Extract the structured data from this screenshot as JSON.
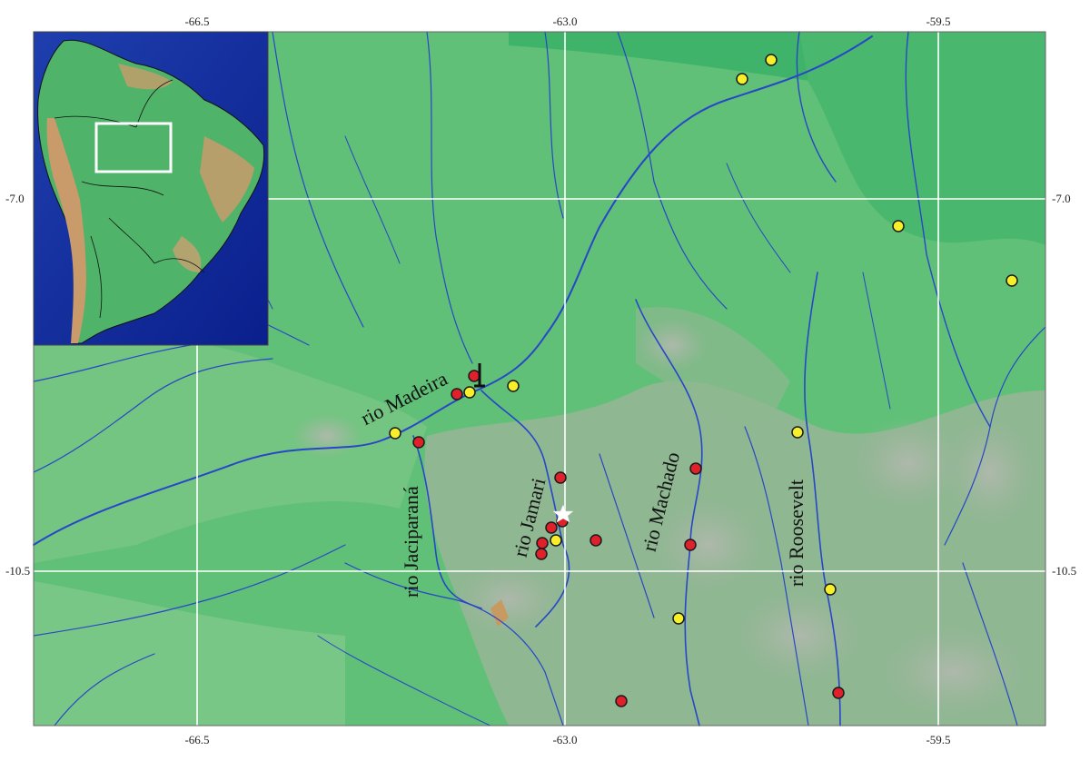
{
  "map": {
    "longitude_labels": [
      "-66.5",
      "-63.0",
      "-59.5"
    ],
    "latitude_labels": [
      "-7.0",
      "-10.5"
    ],
    "colors": {
      "lowland": "#5ec07a",
      "lowland_light": "#8fcf8f",
      "upland": "#9ab89a",
      "rivers": "#2846c8",
      "grid": "#ffffff",
      "red_marker": "#e0202a",
      "yellow_marker": "#f6ef2a"
    }
  },
  "river_labels": {
    "madeira": "rio Madeira",
    "jaciparana": "rio Jaciparaná",
    "jamari": "rio Jamari",
    "machado": "rio Machado",
    "roosevelt": "rio Roosevelt"
  },
  "legend_icons": {
    "star": "white-star-icon"
  },
  "inset": {
    "description_icon": "south-america-inset-map",
    "highlight_box_color": "#ffffff"
  }
}
